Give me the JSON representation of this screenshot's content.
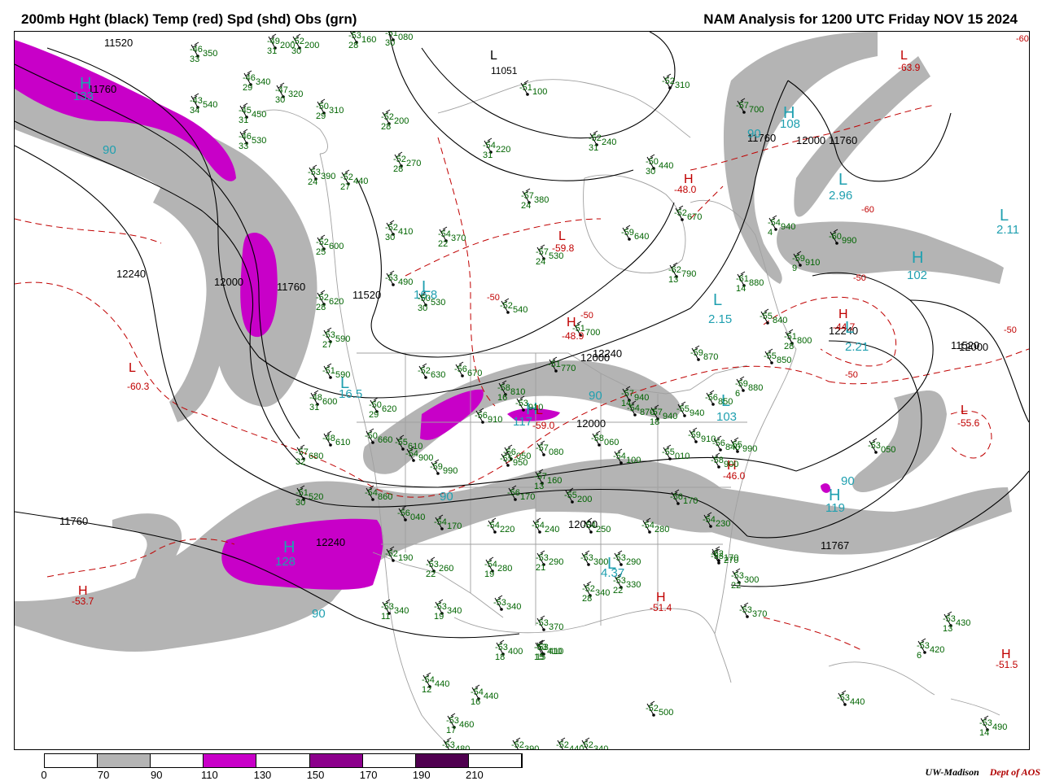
{
  "header": {
    "left_title": "200mb Hght (black) Temp (red) Spd (shd) Obs (grn)",
    "right_title": "NAM Analysis for 1200 UTC Friday  NOV 15 2024"
  },
  "colors": {
    "height_contour": "#000000",
    "temp_contour": "#c00000",
    "obs": "#006400",
    "speed_label": "#20a0b0",
    "band_70_90": "#b4b4b4",
    "band_110_130": "#c800c8",
    "band_150_170": "#8c008c",
    "band_190_210": "#500050",
    "map_boundaries": "#a0a0a0"
  },
  "colorbar": {
    "ticks": [
      "0",
      "70",
      "90",
      "110",
      "130",
      "150",
      "170",
      "190",
      "210"
    ],
    "segments": [
      {
        "color": "#ffffff"
      },
      {
        "color": "#b4b4b4"
      },
      {
        "color": "#ffffff"
      },
      {
        "color": "#c800c8"
      },
      {
        "color": "#ffffff"
      },
      {
        "color": "#8c008c"
      },
      {
        "color": "#ffffff"
      },
      {
        "color": "#500050"
      },
      {
        "color": "#ffffff"
      }
    ]
  },
  "credit": {
    "org": "UW-Madison",
    "dept": "Dept of AOS"
  },
  "height_labels": [
    "11520",
    "11760",
    "12240",
    "12000",
    "11760",
    "11520",
    "11760",
    "12000",
    "12240",
    "11520",
    "11760",
    "12000",
    "11767",
    "12000",
    "12240",
    "12000",
    "12240",
    "11760",
    "12000"
  ],
  "pressure_centers": [
    {
      "letter": "L",
      "value": "11051",
      "kind": "height"
    },
    {
      "letter": "H",
      "value": "-48.0",
      "kind": "temp"
    },
    {
      "letter": "H",
      "value": "-44.7",
      "kind": "temp"
    },
    {
      "letter": "L",
      "value": "-55.6",
      "kind": "temp"
    },
    {
      "letter": "H",
      "value": "-53.7",
      "kind": "temp"
    },
    {
      "letter": "H",
      "value": "-51.4",
      "kind": "temp"
    },
    {
      "letter": "H",
      "value": "-51.5",
      "kind": "temp"
    },
    {
      "letter": "L",
      "value": "-59.8",
      "kind": "temp"
    },
    {
      "letter": "H",
      "value": "-46.0",
      "kind": "temp"
    },
    {
      "letter": "H",
      "value": "-48.9",
      "kind": "temp"
    },
    {
      "letter": "L",
      "value": "-59.0",
      "kind": "temp"
    },
    {
      "letter": "L",
      "value": "-60.3",
      "kind": "temp"
    },
    {
      "letter": "L",
      "value": "-63.9",
      "kind": "temp"
    }
  ],
  "speed_centers": [
    {
      "letter": "H",
      "value": "133"
    },
    {
      "letter": "H",
      "value": "108"
    },
    {
      "letter": "L",
      "value": "2.96"
    },
    {
      "letter": "L",
      "value": "2.11"
    },
    {
      "letter": "H",
      "value": "102"
    },
    {
      "letter": "L",
      "value": "2.15"
    },
    {
      "letter": "L",
      "value": "2.21"
    },
    {
      "letter": "L",
      "value": "16.8"
    },
    {
      "letter": "L",
      "value": "16.5"
    },
    {
      "letter": "L",
      "value": "103"
    },
    {
      "letter": "H",
      "value": "128"
    },
    {
      "letter": "L",
      "value": "4.37"
    },
    {
      "letter": "H",
      "value": "117"
    },
    {
      "letter": "H",
      "value": "119"
    }
  ],
  "speed_contour_labels": [
    "90",
    "90",
    "90",
    "90",
    "90",
    "90"
  ],
  "temp_labels": [
    "-60",
    "-50",
    "-50",
    "-50",
    "-60",
    "-50",
    "-50"
  ],
  "observations": [
    {
      "t": "-46",
      "d": "33",
      "h": "350"
    },
    {
      "t": "-49",
      "d": "31",
      "h": "200"
    },
    {
      "t": "-52",
      "d": "30",
      "h": "200"
    },
    {
      "t": "-53",
      "d": "28",
      "h": "160"
    },
    {
      "t": "-51",
      "d": "30",
      "h": "080"
    },
    {
      "t": "-46",
      "d": "29",
      "h": "340"
    },
    {
      "t": "-47",
      "d": "30",
      "h": "320"
    },
    {
      "t": "-50",
      "d": "29",
      "h": "310"
    },
    {
      "t": "-51",
      "d": "",
      "h": "100"
    },
    {
      "t": "-52",
      "d": "",
      "h": "310"
    },
    {
      "t": "-43",
      "d": "34",
      "h": "540"
    },
    {
      "t": "-45",
      "d": "31",
      "h": "450"
    },
    {
      "t": "-52",
      "d": "28",
      "h": "200"
    },
    {
      "t": "-46",
      "d": "33",
      "h": "530"
    },
    {
      "t": "-54",
      "d": "31",
      "h": "220"
    },
    {
      "t": "-52",
      "d": "31",
      "h": "240"
    },
    {
      "t": "-57",
      "d": "",
      "h": "700"
    },
    {
      "t": "-53",
      "d": "24",
      "h": "390"
    },
    {
      "t": "-52",
      "d": "27",
      "h": "440"
    },
    {
      "t": "-52",
      "d": "28",
      "h": "270"
    },
    {
      "t": "-50",
      "d": "30",
      "h": "440"
    },
    {
      "t": "-57",
      "d": "24",
      "h": "380"
    },
    {
      "t": "-52",
      "d": "30",
      "h": "410"
    },
    {
      "t": "-54",
      "d": "22",
      "h": "370"
    },
    {
      "t": "-52",
      "d": "",
      "h": "670"
    },
    {
      "t": "-54",
      "d": "4",
      "h": "940"
    },
    {
      "t": "-52",
      "d": "25",
      "h": "600"
    },
    {
      "t": "-59",
      "d": "",
      "h": "640"
    },
    {
      "t": "-57",
      "d": "24",
      "h": "530"
    },
    {
      "t": "-60",
      "d": "",
      "h": "990"
    },
    {
      "t": "-53",
      "d": "",
      "h": "490"
    },
    {
      "t": "-62",
      "d": "13",
      "h": "790"
    },
    {
      "t": "-59",
      "d": "9",
      "h": "910"
    },
    {
      "t": "-52",
      "d": "28",
      "h": "620"
    },
    {
      "t": "-50",
      "d": "30",
      "h": "530"
    },
    {
      "t": "-52",
      "d": "",
      "h": "540"
    },
    {
      "t": "-61",
      "d": "14",
      "h": "880"
    },
    {
      "t": "-53",
      "d": "27",
      "h": "590"
    },
    {
      "t": "-51",
      "d": "",
      "h": "700"
    },
    {
      "t": "-55",
      "d": "",
      "h": "840"
    },
    {
      "t": "-51",
      "d": "28",
      "h": "800"
    },
    {
      "t": "-59",
      "d": "",
      "h": "870"
    },
    {
      "t": "-51",
      "d": "",
      "h": "590"
    },
    {
      "t": "-52",
      "d": "",
      "h": "630"
    },
    {
      "t": "-56",
      "d": "",
      "h": "670"
    },
    {
      "t": "-51",
      "d": "",
      "h": "770"
    },
    {
      "t": "-55",
      "d": "",
      "h": "850"
    },
    {
      "t": "-48",
      "d": "31",
      "h": "600"
    },
    {
      "t": "-50",
      "d": "29",
      "h": "620"
    },
    {
      "t": "-58",
      "d": "16",
      "h": "810"
    },
    {
      "t": "-59",
      "d": "6",
      "h": "880"
    },
    {
      "t": "-56",
      "d": "",
      "h": "910"
    },
    {
      "t": "-53",
      "d": "",
      "h": "910"
    },
    {
      "t": "-57",
      "d": "14",
      "h": "940"
    },
    {
      "t": "-56",
      "d": "",
      "h": "850"
    },
    {
      "t": "-55",
      "d": "",
      "h": "940"
    },
    {
      "t": "-59",
      "d": "",
      "h": "910"
    },
    {
      "t": "-54",
      "d": "",
      "h": "870"
    },
    {
      "t": "-57",
      "d": "18",
      "h": "940"
    },
    {
      "t": "-56",
      "d": "",
      "h": "840"
    },
    {
      "t": "-55",
      "d": "",
      "h": "990"
    },
    {
      "t": "-48",
      "d": "",
      "h": "610"
    },
    {
      "t": "-50",
      "d": "",
      "h": "660"
    },
    {
      "t": "-55",
      "d": "",
      "h": "610"
    },
    {
      "t": "-54",
      "d": "",
      "h": "900"
    },
    {
      "t": "-55",
      "d": "",
      "h": "950"
    },
    {
      "t": "-58",
      "d": "",
      "h": "060"
    },
    {
      "t": "-55",
      "d": "",
      "h": "010"
    },
    {
      "t": "-58",
      "d": "",
      "h": "900"
    },
    {
      "t": "-57",
      "d": "32",
      "h": "680"
    },
    {
      "t": "-56",
      "d": "",
      "h": "050"
    },
    {
      "t": "-57",
      "d": "",
      "h": "080"
    },
    {
      "t": "-54",
      "d": "",
      "h": "100"
    },
    {
      "t": "-59",
      "d": "",
      "h": "990"
    },
    {
      "t": "-57",
      "d": "13",
      "h": "160"
    },
    {
      "t": "-56",
      "d": "",
      "h": "170"
    },
    {
      "t": "-51",
      "d": "30",
      "h": "520"
    },
    {
      "t": "-54",
      "d": "",
      "h": "860"
    },
    {
      "t": "-55",
      "d": "",
      "h": "200"
    },
    {
      "t": "-56",
      "d": "",
      "h": "170"
    },
    {
      "t": "-56",
      "d": "",
      "h": "040"
    },
    {
      "t": "-54",
      "d": "",
      "h": "170"
    },
    {
      "t": "-54",
      "d": "",
      "h": "220"
    },
    {
      "t": "-54",
      "d": "",
      "h": "240"
    },
    {
      "t": "-54",
      "d": "",
      "h": "250"
    },
    {
      "t": "-54",
      "d": "",
      "h": "280"
    },
    {
      "t": "-54",
      "d": "",
      "h": "230"
    },
    {
      "t": "-52",
      "d": "",
      "h": "170"
    },
    {
      "t": "-53",
      "d": "",
      "h": "050"
    },
    {
      "t": "-52",
      "d": "",
      "h": "190"
    },
    {
      "t": "-53",
      "d": "22",
      "h": "260"
    },
    {
      "t": "-54",
      "d": "19",
      "h": "280"
    },
    {
      "t": "-53",
      "d": "21",
      "h": "290"
    },
    {
      "t": "-53",
      "d": "",
      "h": "300"
    },
    {
      "t": "-53",
      "d": "",
      "h": "290"
    },
    {
      "t": "-53",
      "d": "",
      "h": "270"
    },
    {
      "t": "-53",
      "d": "22",
      "h": "300"
    },
    {
      "t": "-52",
      "d": "28",
      "h": "340"
    },
    {
      "t": "-53",
      "d": "22",
      "h": "330"
    },
    {
      "t": "-53",
      "d": "",
      "h": "370"
    },
    {
      "t": "-53",
      "d": "11",
      "h": "340"
    },
    {
      "t": "-53",
      "d": "19",
      "h": "340"
    },
    {
      "t": "-53",
      "d": "",
      "h": "340"
    },
    {
      "t": "-53",
      "d": "",
      "h": "370"
    },
    {
      "t": "-53",
      "d": "13",
      "h": "430"
    },
    {
      "t": "-53",
      "d": "15",
      "h": "410"
    },
    {
      "t": "-53",
      "d": "18",
      "h": "400"
    },
    {
      "t": "-53",
      "d": "15",
      "h": "410"
    },
    {
      "t": "-53",
      "d": "6",
      "h": "420"
    },
    {
      "t": "-54",
      "d": "12",
      "h": "440"
    },
    {
      "t": "-54",
      "d": "16",
      "h": "440"
    },
    {
      "t": "-53",
      "d": "",
      "h": "440"
    },
    {
      "t": "-53",
      "d": "17",
      "h": "460"
    },
    {
      "t": "-52",
      "d": "",
      "h": "500"
    },
    {
      "t": "-53",
      "d": "14",
      "h": "490"
    },
    {
      "t": "-53",
      "d": "",
      "h": "480"
    },
    {
      "t": "-52",
      "d": "",
      "h": "390"
    },
    {
      "t": "-52",
      "d": "",
      "h": "440"
    },
    {
      "t": "-52",
      "d": "",
      "h": "340"
    }
  ]
}
